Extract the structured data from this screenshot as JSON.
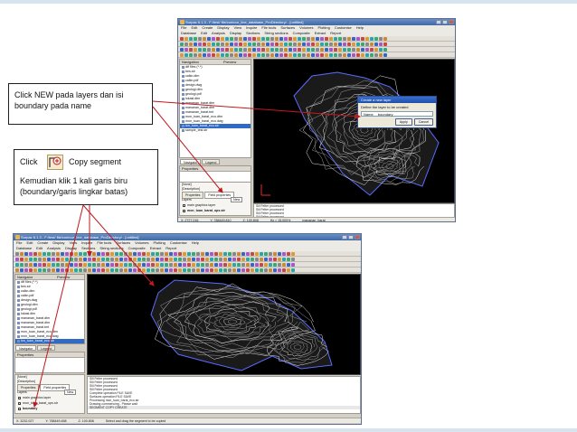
{
  "slide": {
    "callout_new_layer": {
      "text": "Click NEW pada layers dan isi boundary pada name"
    },
    "callout_copy_segment": {
      "click_label": "Click",
      "action_label": "Copy segment",
      "body": "Kemudian klik 1 kali garis biru (boundary/garis lingkar batas)"
    },
    "colors": {
      "arrow": "#c0181f",
      "callout_border": "#1f1f1f",
      "accent": "#d6e4f0"
    }
  },
  "top_window": {
    "title": "Surpac 6.1.3 - F:/test/ file/contour_line_database_ProDirectory/ - [untitled]",
    "menu": [
      "File",
      "Edit",
      "Create",
      "Display",
      "View",
      "Inquire",
      "File tools",
      "Surfaces",
      "Volumes",
      "Plotting",
      "Customise",
      "Help"
    ],
    "menu2": [
      "Database",
      "Edit",
      "Analysis",
      "Display",
      "Sections",
      "String sections",
      "Composite",
      "Extract",
      "Report"
    ],
    "nav": {
      "header": "Navigation",
      "preview": "Preview",
      "folder": "dtf files (*.*)",
      "files": [
        "bes.str",
        "calkn.dtm",
        "calkn.pdf",
        "design.dwg",
        "geologi.dtm",
        "geologi.pdf",
        "lokasi.dtm",
        "mananan_barat.dtm",
        "mananan_barat.dtm",
        "mananan_barat.tmt",
        "mon_tuan_barat_eco.dtm",
        "mon_tuan_barat_eco.dwg",
        "ion_tuan_barat_eco.str",
        "sample_test.str"
      ],
      "selected_index": 12
    },
    "tabs": [
      "Navigator",
      "Legend"
    ],
    "properties_label": "Properties",
    "props_panel": {
      "header": "[None]",
      "desc_label": "[Description]",
      "tab_properties": "Properties",
      "tab_field_properties": "Field properties",
      "layers_label": "Layers",
      "new_label": "New",
      "layers": [
        {
          "name": "main graphics layer",
          "checked": false
        },
        {
          "name": "mon_tuan_barat_ops.str",
          "checked": true
        }
      ]
    },
    "output_lines": [
      "Sill Felter processed",
      "Sill Felter processed",
      "Sill Felter processed",
      "Sill Felter processed",
      "Surfaces operation FILE SAVE",
      "Processing mon_tuan_barat_eco.str",
      "Drawing commencing - Please wait"
    ],
    "output_prompt": "ENTER LAYER NAME",
    "status": {
      "x": "X: 2727.016",
      "y": "Y: 788449.810",
      "z": "Z: 100.808",
      "hz": "Hz = 15.000%",
      "layer": "mananan_barat"
    },
    "dialog": {
      "title": "Create a new layer",
      "prompt": "Define the layer to be created",
      "name_label": "Name",
      "name_value": "boundary",
      "apply": "Apply",
      "cancel": "Cancel"
    }
  },
  "bottom_window": {
    "title": "Surpac 6.1.3 - F:/test/ file/contour_line_database_ProDirectory/ - [untitled]",
    "menu": [
      "File",
      "Edit",
      "Create",
      "Display",
      "View",
      "Inquire",
      "File tools",
      "Surfaces",
      "Volumes",
      "Plotting",
      "Customise",
      "Help"
    ],
    "menu2": [
      "Database",
      "Edit",
      "Analysis",
      "Display",
      "Sections",
      "String sections",
      "Composite",
      "Extract",
      "Report"
    ],
    "nav": {
      "header": "Navigator",
      "preview": "Preview",
      "folder": "dtf files (*.*)",
      "files": [
        "bes.str",
        "calkn.dtm",
        "calkn.pdf",
        "design.dwg",
        "geologi.dtm",
        "geologi.pdf",
        "lokasi.dtm",
        "mananan_barat.dtm",
        "mananan_barat.dtm",
        "mananan_barat.tmt",
        "mon_tuan_barat_eco.dtm",
        "mon_tuan_barat_eco.dwg",
        "ion_tuan_barat_eco.str",
        "sample_test.str"
      ],
      "selected_index": 12
    },
    "tabs": [
      "Navigator",
      "Legend"
    ],
    "properties_label": "Properties",
    "props_panel": {
      "header": "[None]",
      "desc_label": "[Description]",
      "tab_properties": "Properties",
      "tab_field_properties": "Field properties",
      "layers_label": "Layers",
      "new_label": "New",
      "layers": [
        {
          "name": "main graphics layer",
          "checked": false
        },
        {
          "name": "mon_tuan_barat_ops.str",
          "checked": true
        },
        {
          "name": "boundary",
          "checked": true
        }
      ]
    },
    "output_lines": [
      "Sill Felter processed",
      "Sill Felter processed",
      "Sill Felter processed",
      "Sill Felter processed",
      "Complete operation FILE SAVE",
      "Surfaces operation FILE SAVE",
      "Processing mon_tuan_barat_eco.str",
      "Drawing commencing - Please wait"
    ],
    "output_prompt": "SEGMENT COPY CREATE",
    "status": {
      "x": "X: 3232.027",
      "y": "Y: 788449.458",
      "z": "Z: 100.808",
      "hint": "Select and drag the segment to be copied"
    }
  }
}
